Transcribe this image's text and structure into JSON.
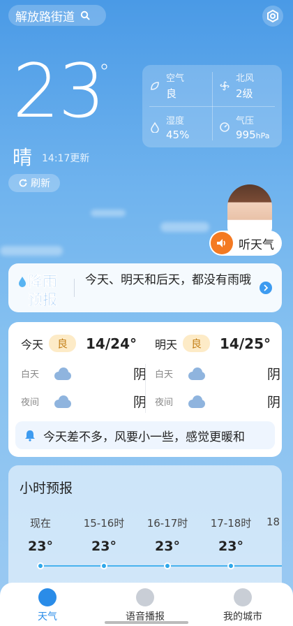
{
  "location": {
    "name": "解放路街道"
  },
  "current": {
    "temp": "23",
    "unit": "°",
    "condition": "晴",
    "updated": "14:17更新",
    "refresh_label": "刷新"
  },
  "metrics": [
    {
      "label": "空气",
      "value": "良",
      "icon": "leaf-icon"
    },
    {
      "label": "北风",
      "value": "2级",
      "icon": "wind-icon"
    },
    {
      "label": "湿度",
      "value": "45%",
      "icon": "humidity-icon"
    },
    {
      "label": "气压",
      "value": "995",
      "unit": "hPa",
      "icon": "pressure-icon"
    }
  ],
  "listen": {
    "label": "听天气"
  },
  "rain": {
    "badge_line1": "降雨",
    "badge_line2": "预报",
    "text": "今天、明天和后天，都没有雨哦"
  },
  "days": [
    {
      "name": "今天",
      "aqi": "良",
      "range": "14/24°",
      "day_label": "白天",
      "day_cond": "阴",
      "night_label": "夜间",
      "night_cond": "阴"
    },
    {
      "name": "明天",
      "aqi": "良",
      "range": "14/25°",
      "day_label": "白天",
      "day_cond": "阴",
      "night_label": "夜间",
      "night_cond": "阴"
    }
  ],
  "tip": "今天差不多，风要小一些，感觉更暖和",
  "hourly": {
    "title": "小时预报",
    "items": [
      {
        "time": "现在",
        "temp": "23°"
      },
      {
        "time": "15-16时",
        "temp": "23°"
      },
      {
        "time": "16-17时",
        "temp": "23°"
      },
      {
        "time": "17-18时",
        "temp": "23°"
      },
      {
        "time": "18",
        "temp": ""
      }
    ]
  },
  "nav": [
    {
      "label": "天气",
      "icon": "weather-icon",
      "active": true
    },
    {
      "label": "语音播报",
      "icon": "voice-icon",
      "active": false
    },
    {
      "label": "我的城市",
      "icon": "location-pin-icon",
      "active": false
    }
  ],
  "colors": {
    "accent": "#2a8ce8",
    "orange": "#f47a22",
    "badge_bg": "#fdebc7"
  }
}
